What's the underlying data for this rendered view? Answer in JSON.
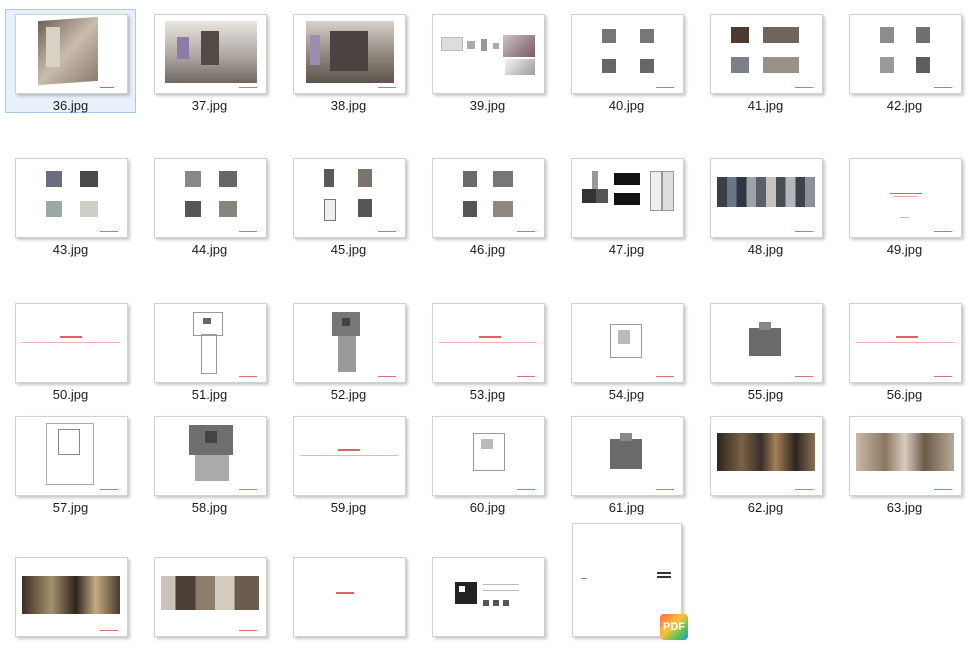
{
  "files": [
    {
      "name": "36.jpg",
      "selected": true
    },
    {
      "name": "37.jpg"
    },
    {
      "name": "38.jpg"
    },
    {
      "name": "39.jpg"
    },
    {
      "name": "40.jpg"
    },
    {
      "name": "41.jpg"
    },
    {
      "name": "42.jpg"
    },
    {
      "name": "43.jpg"
    },
    {
      "name": "44.jpg"
    },
    {
      "name": "45.jpg"
    },
    {
      "name": "46.jpg"
    },
    {
      "name": "47.jpg"
    },
    {
      "name": "48.jpg"
    },
    {
      "name": "49.jpg"
    },
    {
      "name": "50.jpg"
    },
    {
      "name": "51.jpg"
    },
    {
      "name": "52.jpg"
    },
    {
      "name": "53.jpg"
    },
    {
      "name": "54.jpg"
    },
    {
      "name": "55.jpg"
    },
    {
      "name": "56.jpg"
    },
    {
      "name": "57.jpg"
    },
    {
      "name": "58.jpg"
    },
    {
      "name": "59.jpg"
    },
    {
      "name": "60.jpg"
    },
    {
      "name": "61.jpg"
    },
    {
      "name": "62.jpg"
    },
    {
      "name": "63.jpg"
    },
    {
      "name": ""
    },
    {
      "name": ""
    },
    {
      "name": ""
    },
    {
      "name": ""
    },
    {
      "name": ""
    }
  ],
  "badge": {
    "label": "PDF"
  }
}
